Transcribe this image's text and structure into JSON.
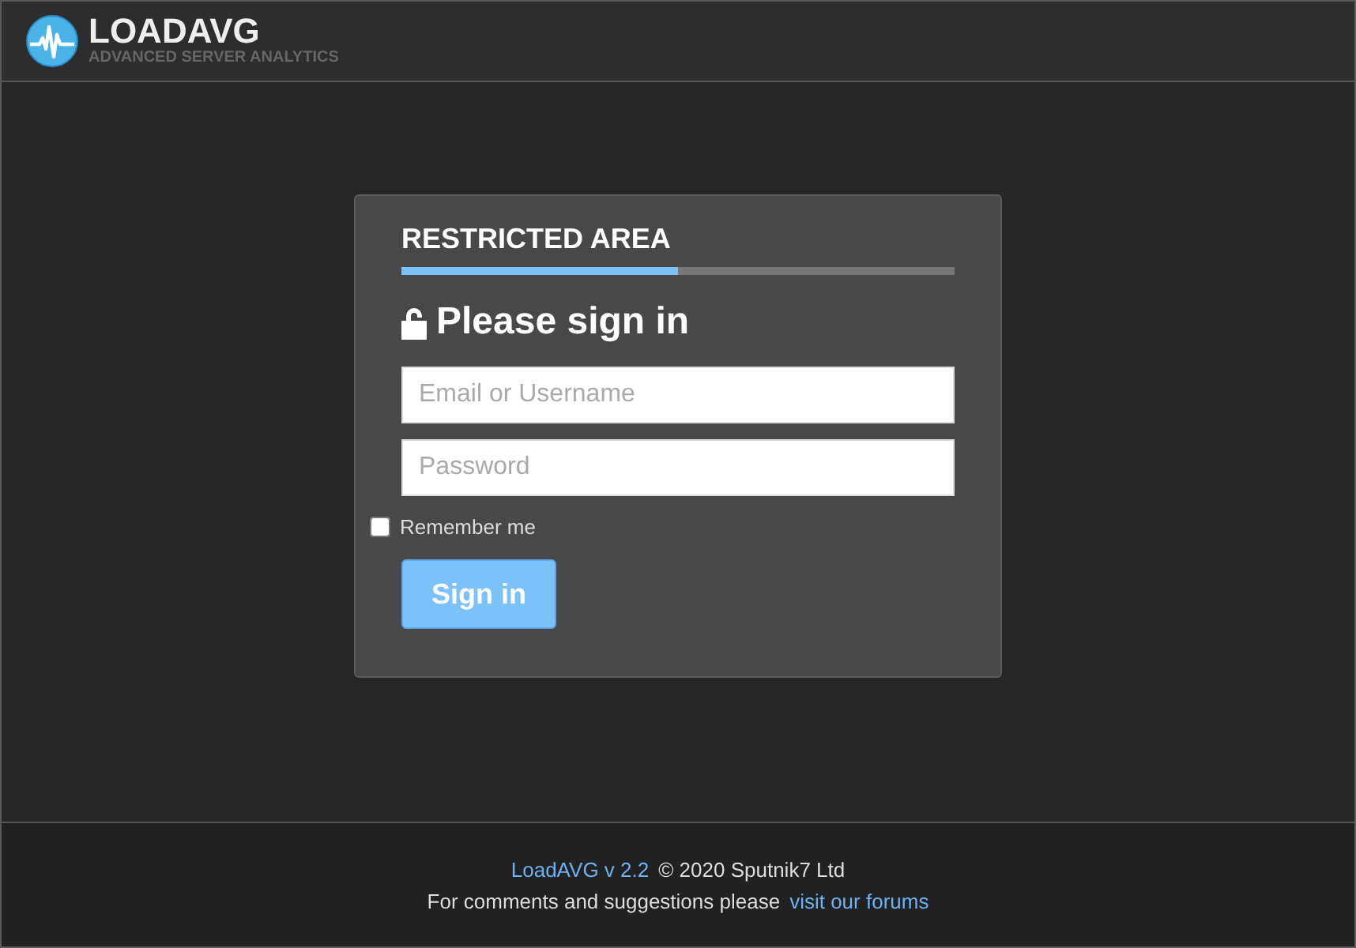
{
  "header": {
    "title": "LOADAVG",
    "subtitle": "ADVANCED SERVER ANALYTICS"
  },
  "login": {
    "heading": "RESTRICTED AREA",
    "title": "Please sign in",
    "fields": [
      {
        "placeholder": "Email or Username"
      },
      {
        "placeholder": "Password"
      }
    ],
    "remember": {
      "label": "Remember me",
      "checked": false
    },
    "button": "Sign in"
  },
  "footer": {
    "version_link": "LoadAVG v 2.2",
    "copyright": "© 2020 Sputnik7 Ltd",
    "comment": "For comments and suggestions please",
    "forums_link": "visit our forums"
  }
}
